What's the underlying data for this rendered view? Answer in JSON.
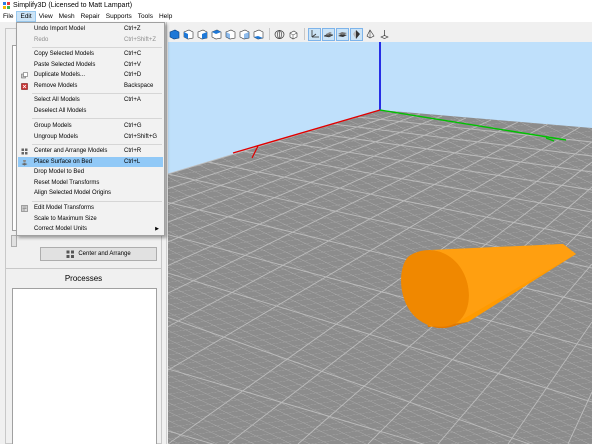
{
  "window": {
    "title": "Simplify3D (Licensed to Matt Lampart)"
  },
  "menubar": {
    "items": [
      {
        "label": "File"
      },
      {
        "label": "Edit"
      },
      {
        "label": "View"
      },
      {
        "label": "Mesh"
      },
      {
        "label": "Repair"
      },
      {
        "label": "Supports"
      },
      {
        "label": "Tools"
      },
      {
        "label": "Help"
      }
    ]
  },
  "edit_menu": {
    "undo": {
      "label": "Undo Import Model",
      "shortcut": "Ctrl+Z"
    },
    "redo": {
      "label": "Redo",
      "shortcut": "Ctrl+Shift+Z"
    },
    "copy_selected": {
      "label": "Copy Selected Models",
      "shortcut": "Ctrl+C"
    },
    "paste_selected": {
      "label": "Paste Selected Models",
      "shortcut": "Ctrl+V"
    },
    "duplicate": {
      "label": "Duplicate Models...",
      "shortcut": "Ctrl+D"
    },
    "remove": {
      "label": "Remove Models",
      "shortcut": "Backspace"
    },
    "select_all": {
      "label": "Select All Models",
      "shortcut": "Ctrl+A"
    },
    "deselect_all": {
      "label": "Deselect All Models"
    },
    "group": {
      "label": "Group Models",
      "shortcut": "Ctrl+G"
    },
    "ungroup": {
      "label": "Ungroup Models",
      "shortcut": "Ctrl+Shift+G"
    },
    "center_arrange": {
      "label": "Center and Arrange Models",
      "shortcut": "Ctrl+R"
    },
    "place_surface": {
      "label": "Place Surface on Bed",
      "shortcut": "Ctrl+L"
    },
    "drop_to_bed": {
      "label": "Drop Model to Bed"
    },
    "reset_transforms": {
      "label": "Reset Model Transforms"
    },
    "align_origins": {
      "label": "Align Selected Model Origins"
    },
    "edit_transforms": {
      "label": "Edit Model Transforms"
    },
    "scale_max": {
      "label": "Scale to Maximum Size"
    },
    "correct_units": {
      "label": "Correct Model Units"
    }
  },
  "left_panel": {
    "center_arrange_button": "Center and Arrange",
    "processes_title": "Processes"
  },
  "colors": {
    "accent_highlight": "#91c9f7",
    "model_orange": "#ff9a00",
    "bed_grey": "#8c8c8c",
    "sky_blue": "#bfe0fb",
    "axis_x": "#e00000",
    "axis_y": "#00c000",
    "axis_z": "#0000e0"
  }
}
